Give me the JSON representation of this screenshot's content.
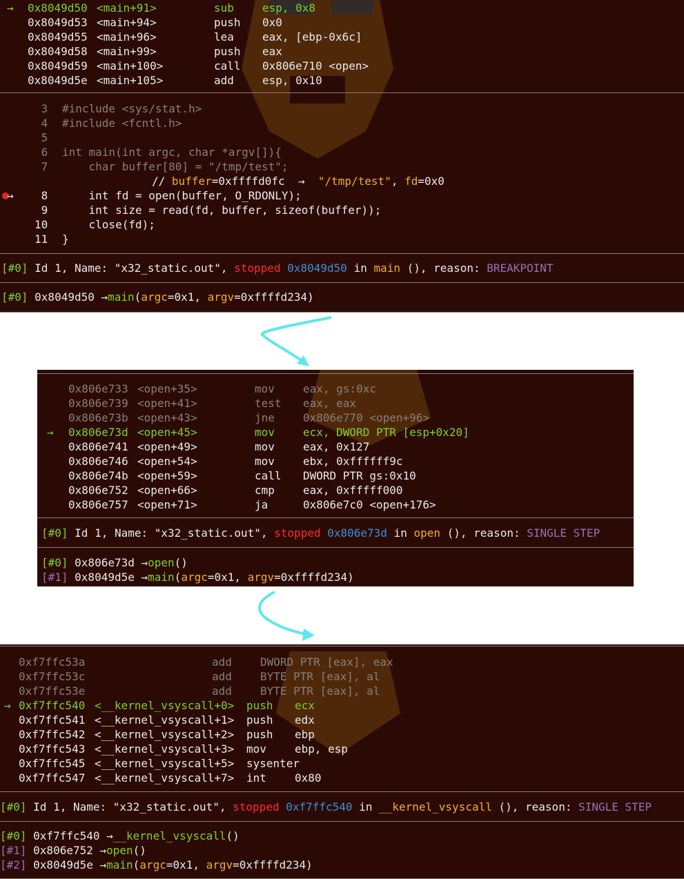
{
  "colors": {
    "panel_bg": "#2b0a06",
    "green": "#7fd12a",
    "yellow": "#f2b01e",
    "blue": "#3d8fd6",
    "red": "#ff2a2a",
    "purple": "#9b6fb6",
    "arrow": "#5fe6f0"
  },
  "panel1": {
    "disasm": [
      {
        "arrow": "→",
        "addr": "0x8049d50",
        "sym": "<main+91>",
        "op": "sub",
        "args": "esp, 0x8"
      },
      {
        "arrow": "",
        "addr": "0x8049d53",
        "sym": "<main+94>",
        "op": "push",
        "args": "0x0"
      },
      {
        "arrow": "",
        "addr": "0x8049d55",
        "sym": "<main+96>",
        "op": "lea",
        "args": "eax, [ebp-0x6c]"
      },
      {
        "arrow": "",
        "addr": "0x8049d58",
        "sym": "<main+99>",
        "op": "push",
        "args": "eax"
      },
      {
        "arrow": "",
        "addr": "0x8049d59",
        "sym": "<main+100>",
        "op": "call",
        "args": "0x806e710 <open>"
      },
      {
        "arrow": "",
        "addr": "0x8049d5e",
        "sym": "<main+105>",
        "op": "add",
        "args": "esp, 0x10"
      }
    ],
    "source": [
      {
        "num": "3",
        "code": "#include <sys/stat.h>"
      },
      {
        "num": "4",
        "code": "#include <fcntl.h>"
      },
      {
        "num": "5",
        "code": ""
      },
      {
        "num": "6",
        "code": "int main(int argc, char *argv[]){"
      },
      {
        "num": "7",
        "code": "    char buffer[80] = \"/tmp/test\";"
      }
    ],
    "comment": {
      "prefix": "// ",
      "var": "buffer",
      "eq": "=0xffffd0fc",
      "arrow": "  →  ",
      "str": "\"/tmp/test\"",
      "sep": ", ",
      "var2": "fd",
      "val2": "=0x0"
    },
    "current": {
      "marker": "→",
      "num": "8",
      "code": "    int fd = open(buffer, O_RDONLY);"
    },
    "source2": [
      {
        "num": "9",
        "code": "    int size = read(fd, buffer, sizeof(buffer));"
      },
      {
        "num": "10",
        "code": "    close(fd);"
      },
      {
        "num": "11",
        "code": "}"
      }
    ],
    "thread": {
      "idx": "[#0]",
      "mid": " Id 1, Name: \"x32_static.out\", ",
      "stopped": "stopped",
      "addr": "0x8049d50",
      "in": " in ",
      "func": "main",
      "rest": " (), reason: ",
      "reason": "BREAKPOINT"
    },
    "trace": [
      {
        "idx": "[#0]",
        "addr": "0x8049d50",
        "arrow": "→",
        "func": "main",
        "args": [
          {
            "t": "(",
            "c": "w"
          },
          {
            "t": "argc",
            "c": "y"
          },
          {
            "t": "=0x1, ",
            "c": "w"
          },
          {
            "t": "argv",
            "c": "y"
          },
          {
            "t": "=0xffffd234)",
            "c": "w"
          }
        ]
      }
    ]
  },
  "panel2": {
    "disasm_dim": [
      {
        "addr": "0x806e733",
        "sym": "<open+35>",
        "op": "mov",
        "args": "eax, gs:0xc"
      },
      {
        "addr": "0x806e739",
        "sym": "<open+41>",
        "op": "test",
        "args": "eax, eax"
      },
      {
        "addr": "0x806e73b",
        "sym": "<open+43>",
        "op": "jne",
        "args": "0x806e770 <open+96>"
      }
    ],
    "current": {
      "arrow": "→",
      "addr": "0x806e73d",
      "sym": "<open+45>",
      "op": "mov",
      "args": "ecx, DWORD PTR [esp+0x20]"
    },
    "disasm": [
      {
        "addr": "0x806e741",
        "sym": "<open+49>",
        "op": "mov",
        "args": "eax, 0x127"
      },
      {
        "addr": "0x806e746",
        "sym": "<open+54>",
        "op": "mov",
        "args": "ebx, 0xffffff9c"
      },
      {
        "addr": "0x806e74b",
        "sym": "<open+59>",
        "op": "call",
        "args": "DWORD PTR gs:0x10"
      },
      {
        "addr": "0x806e752",
        "sym": "<open+66>",
        "op": "cmp",
        "args": "eax, 0xfffff000"
      },
      {
        "addr": "0x806e757",
        "sym": "<open+71>",
        "op": "ja",
        "args": "0x806e7c0 <open+176>"
      }
    ],
    "thread": {
      "idx": "[#0]",
      "mid": " Id 1, Name: \"x32_static.out\", ",
      "stopped": "stopped",
      "addr": "0x806e73d",
      "in": " in ",
      "func": "open",
      "rest": " (), reason: ",
      "reason": "SINGLE STEP"
    },
    "trace": [
      {
        "idx": "[#0]",
        "addr": "0x806e73d",
        "arrow": "→",
        "func": "open",
        "args": [
          {
            "t": "()",
            "c": "w"
          }
        ]
      },
      {
        "idx": "[#1]",
        "addr": "0x8049d5e",
        "arrow": "→",
        "func": "main",
        "args": [
          {
            "t": "(",
            "c": "w"
          },
          {
            "t": "argc",
            "c": "y"
          },
          {
            "t": "=0x1, ",
            "c": "w"
          },
          {
            "t": "argv",
            "c": "y"
          },
          {
            "t": "=0xffffd234)",
            "c": "w"
          }
        ]
      }
    ]
  },
  "panel3": {
    "disasm_dim": [
      {
        "addr": "0xf7ffc53a",
        "sym": "",
        "op": "add",
        "args": "DWORD PTR [eax], eax"
      },
      {
        "addr": "0xf7ffc53c",
        "sym": "",
        "op": "add",
        "args": "BYTE PTR [eax], al"
      },
      {
        "addr": "0xf7ffc53e",
        "sym": "",
        "op": "add",
        "args": "BYTE PTR [eax], al"
      }
    ],
    "current": {
      "arrow": "→",
      "addr": "0xf7ffc540",
      "sym": "<__kernel_vsyscall+0>",
      "op": "push",
      "args": "ecx"
    },
    "disasm": [
      {
        "addr": "0xf7ffc541",
        "sym": "<__kernel_vsyscall+1>",
        "op": "push",
        "args": "edx"
      },
      {
        "addr": "0xf7ffc542",
        "sym": "<__kernel_vsyscall+2>",
        "op": "push",
        "args": "ebp"
      },
      {
        "addr": "0xf7ffc543",
        "sym": "<__kernel_vsyscall+3>",
        "op": "mov",
        "args": "ebp, esp"
      },
      {
        "addr": "0xf7ffc545",
        "sym": "<__kernel_vsyscall+5>",
        "op": "sysenter",
        "args": ""
      },
      {
        "addr": "0xf7ffc547",
        "sym": "<__kernel_vsyscall+7>",
        "op": "int",
        "args": "0x80"
      }
    ],
    "thread": {
      "idx": "[#0]",
      "mid": " Id 1, Name: \"x32_static.out\", ",
      "stopped": "stopped",
      "addr": "0xf7ffc540",
      "in": " in ",
      "func": "__kernel_vsyscall",
      "rest": " (), reason: ",
      "reason": "SINGLE STEP"
    },
    "trace": [
      {
        "idx": "[#0]",
        "addr": "0xf7ffc540",
        "arrow": "→",
        "func": "__kernel_vsyscall",
        "args": [
          {
            "t": "()",
            "c": "w"
          }
        ]
      },
      {
        "idx": "[#1]",
        "addr": "0x806e752",
        "arrow": "→",
        "func": "open",
        "args": [
          {
            "t": "()",
            "c": "w"
          }
        ]
      },
      {
        "idx": "[#2]",
        "addr": "0x8049d5e",
        "arrow": "→",
        "func": "main",
        "args": [
          {
            "t": "(",
            "c": "w"
          },
          {
            "t": "argc",
            "c": "y"
          },
          {
            "t": "=0x1, ",
            "c": "w"
          },
          {
            "t": "argv",
            "c": "y"
          },
          {
            "t": "=0xffffd234)",
            "c": "w"
          }
        ]
      }
    ]
  }
}
